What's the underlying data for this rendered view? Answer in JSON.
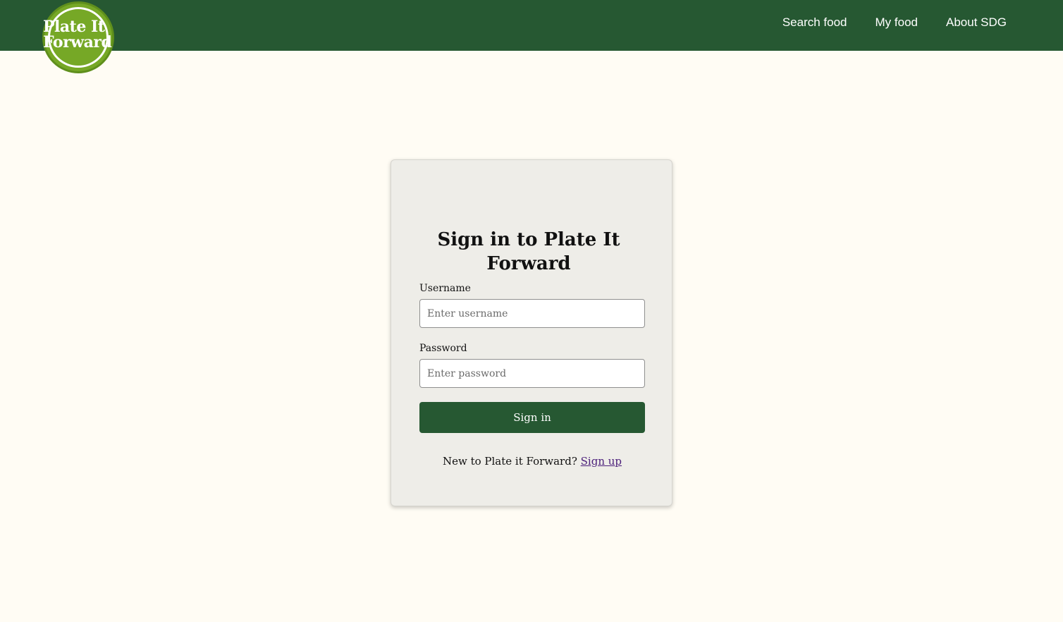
{
  "brand": {
    "logo_line1": "Plate It",
    "logo_line2": "Forward"
  },
  "nav": {
    "items": [
      {
        "label": "Search food"
      },
      {
        "label": "My food"
      },
      {
        "label": "About SDG"
      }
    ]
  },
  "signin": {
    "title": "Sign in to Plate It Forward",
    "username_label": "Username",
    "username_placeholder": "Enter username",
    "username_value": "",
    "password_label": "Password",
    "password_placeholder": "Enter password",
    "password_value": "",
    "submit_label": "Sign in",
    "signup_prompt": "New to Plate it Forward?",
    "signup_link": "Sign up"
  },
  "colors": {
    "header_bg": "#265832",
    "page_bg": "#fffcf4",
    "card_bg": "#eeede8",
    "logo_green": "#76a826",
    "link_purple": "#4b1f7a"
  }
}
